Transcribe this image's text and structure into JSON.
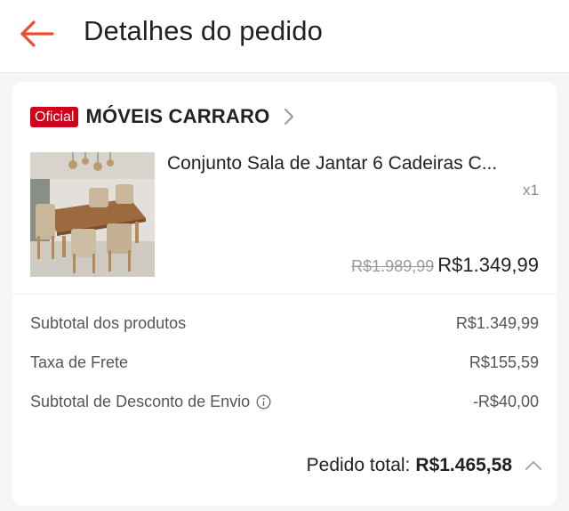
{
  "header": {
    "title": "Detalhes do pedido",
    "back_icon": "arrow-left-icon",
    "accent_color": "#ee4d2d"
  },
  "shop": {
    "badge": "Oficial",
    "badge_color": "#d0011b",
    "name": "MÓVEIS CARRARO",
    "chevron_icon": "chevron-right-icon"
  },
  "product": {
    "image_icon": "dining-set-photo",
    "name": "Conjunto Sala de Jantar 6 Cadeiras C...",
    "quantity": "x1",
    "original_price": "R$1.989,99",
    "price": "R$1.349,99"
  },
  "summary": {
    "lines": [
      {
        "label": "Subtotal dos produtos",
        "value": "R$1.349,99"
      },
      {
        "label": "Taxa de Frete",
        "value": "R$155,59"
      },
      {
        "label": "Subtotal de Desconto de Envio",
        "value": "-R$40,00",
        "info_icon": "info-circle-icon"
      }
    ],
    "total_label": "Pedido total:",
    "total_value": "R$1.465,58",
    "collapse_icon": "chevron-up-icon"
  }
}
